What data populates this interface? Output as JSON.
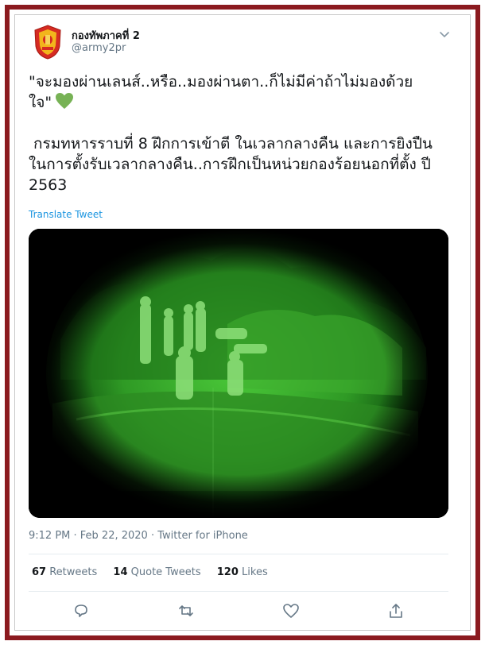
{
  "user": {
    "name": "กองทัพภาคที่ 2",
    "handle": "@army2pr"
  },
  "tweet": {
    "line1": "\"จะมองผ่านเลนส์..หรือ..มองผ่านตา..ก็ไม่มีค่าถ้าไม่มองด้วย",
    "line2": "ใจ\"",
    "emoji": "green-heart",
    "paragraph2": " กรมทหารราบที่ 8 ฝึกการเข้าตี ในเวลากลางคืน และการยิงปืน ในการตั้งรับเวลากลางคืน..การฝึกเป็นหน่วยกองร้อยนอกที่ตั้ง ปี 2563",
    "translate_label": "Translate Tweet"
  },
  "meta": {
    "timestamp": "9:12 PM · Feb 22, 2020 · Twitter for iPhone"
  },
  "stats": {
    "retweets_count": "67",
    "retweets_label": "Retweets",
    "quotes_count": "14",
    "quotes_label": "Quote Tweets",
    "likes_count": "120",
    "likes_label": "Likes"
  },
  "colors": {
    "frame": "#8b1a1f",
    "link": "#1b95e0",
    "night_vision": "#3fbf3f"
  }
}
